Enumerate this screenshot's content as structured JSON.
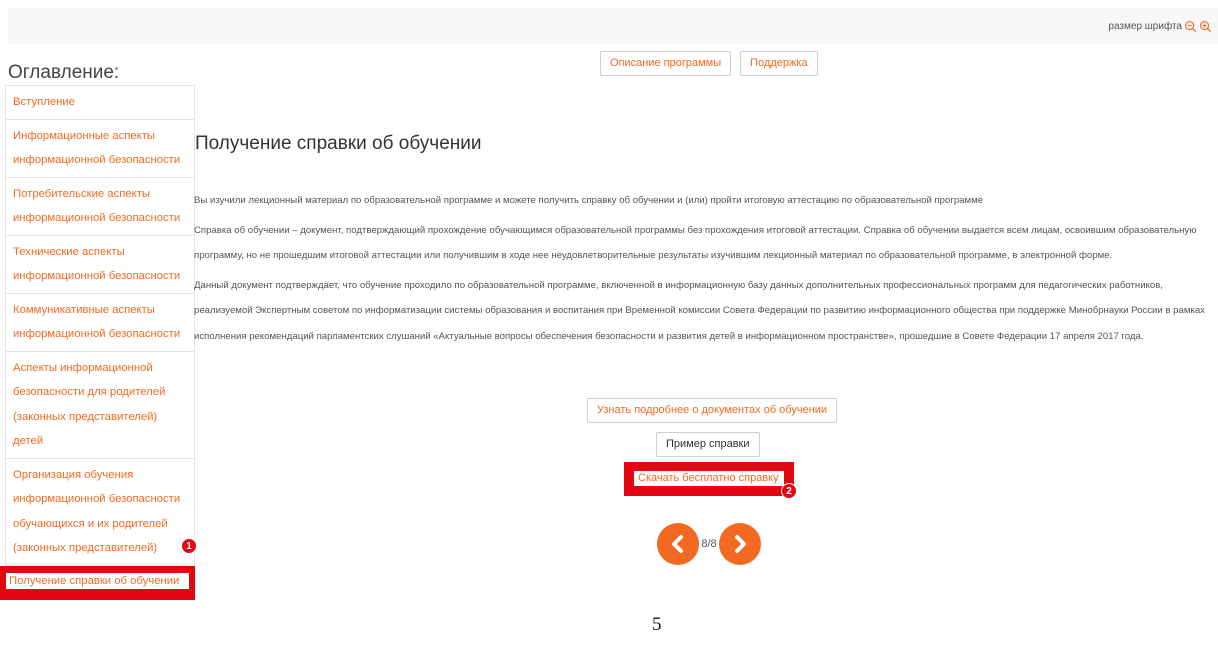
{
  "header": {
    "font_size_label": "размер шрифта"
  },
  "toc": {
    "title": "Оглавление:",
    "items": [
      {
        "label": "Вступление"
      },
      {
        "label": "Информационные аспекты информационной безопасности"
      },
      {
        "label": "Потребительские аспекты информационной безопасности"
      },
      {
        "label": "Технические аспекты информационной безопасности"
      },
      {
        "label": "Коммуникативные аспекты информационной безопасности"
      },
      {
        "label": "Аспекты информационной безопасности для родителей (законных представителей) детей"
      },
      {
        "label": "Организация обучения информационной безопасности обучающихся и их родителей (законных представителей)"
      },
      {
        "label": "Получение справки об обучении"
      }
    ]
  },
  "nav": {
    "description_label": "Описание программы",
    "support_label": "Поддержка"
  },
  "main": {
    "title": "Получение справки об обучении",
    "paragraphs": [
      "Вы изучили лекционный материал по образовательной программе и можете получить справку об обучении и (или) пройти итоговую аттестацию по образовательной программе",
      "Справка об обучении – документ, подтверждающий прохождение обучающимся образовательной программы без прохождения итоговой аттестации. Справка об обучении выдается всем лицам, освоившим образовательную программу, но не прошедшим итоговой аттестации или получившим в ходе нее неудовлетворительные результаты изучившим лекционный материал по образовательной программе, в электронной форме.",
      "Данный документ подтверждает, что обучение проходило по образовательной программе, включенной в информационную базу данных дополнительных профессиональных программ для педагогических работников, реализуемой Экспертным советом по информатизации системы образования и воспитания при Временной комиссии Совета Федерации по развитию информационного общества при поддержке Минобрнауки России в рамках исполнения рекомендаций парламентских слушаний «Актуальные вопросы обеспечения безопасности и развития детей в информационном пространстве», прошедшие в Совете Федерации 17 апреля 2017 года."
    ],
    "more_docs_label": "Узнать подробнее о документах об обучении",
    "sample_label": "Пример справки",
    "download_label": "Скачать бесплатно справку"
  },
  "pager": {
    "count": "8/8"
  },
  "markers": {
    "first": "1",
    "second": "2"
  },
  "page_number": "5",
  "colors": {
    "accent": "#f26a21",
    "highlight": "#e30613"
  },
  "icons": {
    "zoom_out": "zoom-out-icon",
    "zoom_in": "zoom-in-icon",
    "prev": "chevron-left-icon",
    "next": "chevron-right-icon"
  }
}
